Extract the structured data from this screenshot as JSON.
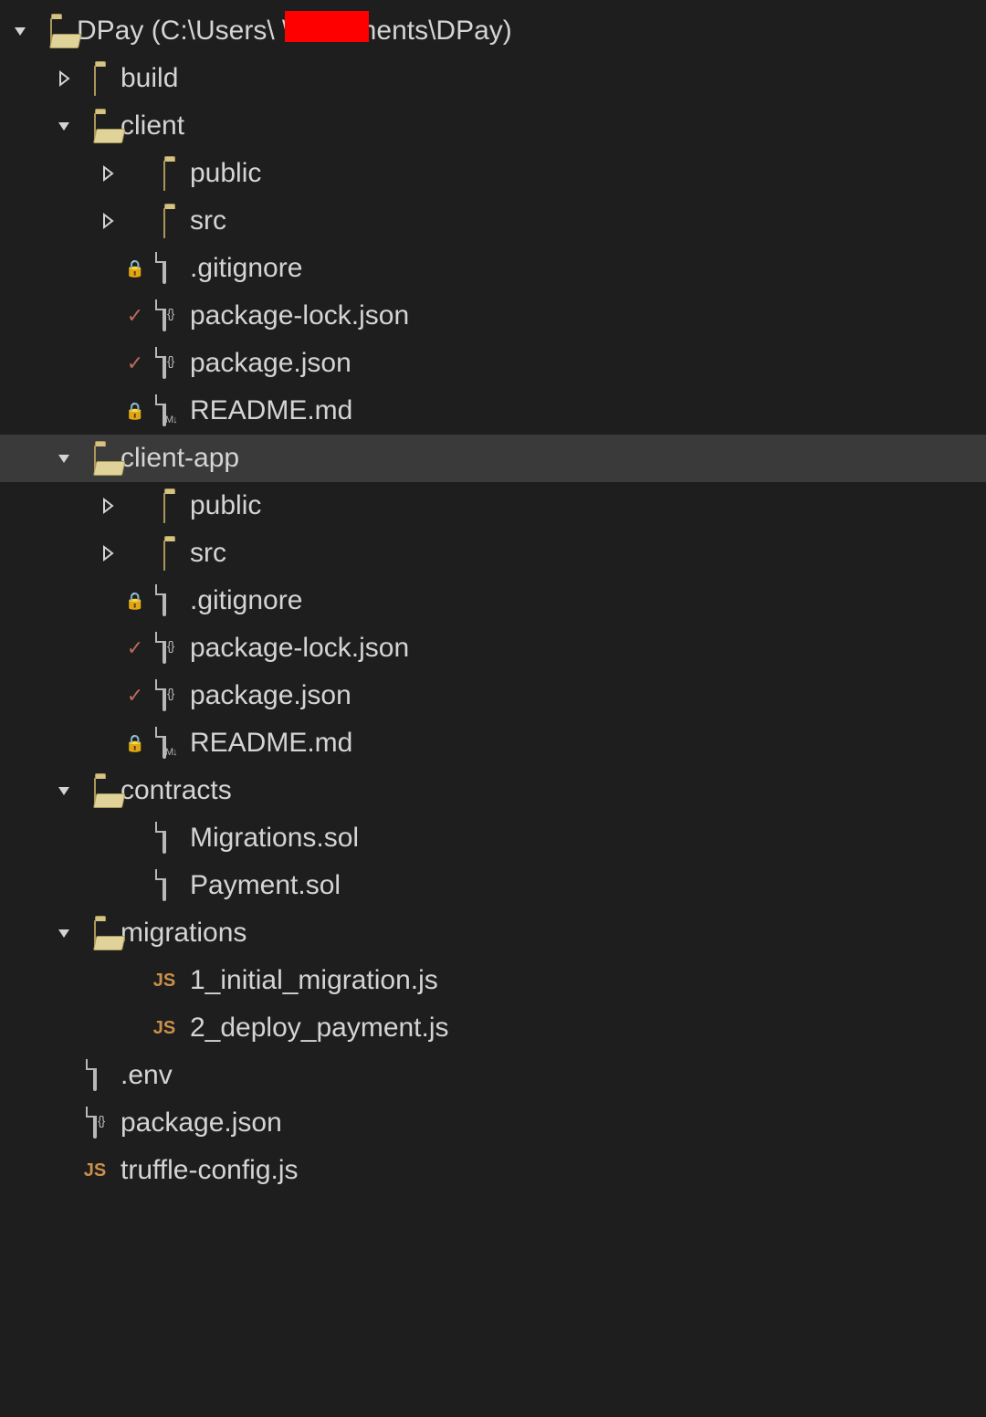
{
  "rootLabel": "DPay (C:\\Users\\        \\Documents\\DPay)",
  "selectedLabel": "client-app",
  "nodes": [
    {
      "depth": 0,
      "expander": "down",
      "icon": "folder-open",
      "label_key": "n0",
      "redact": true
    },
    {
      "depth": 1,
      "expander": "right",
      "icon": "folder",
      "label_key": "n1"
    },
    {
      "depth": 1,
      "expander": "down",
      "icon": "folder-open",
      "label_key": "n2"
    },
    {
      "depth": 2,
      "expander": "right",
      "icon": "folder",
      "label_key": "n3"
    },
    {
      "depth": 2,
      "expander": "right",
      "icon": "folder",
      "label_key": "n4"
    },
    {
      "depth": 2,
      "status": "lock",
      "icon": "file",
      "label_key": "n5"
    },
    {
      "depth": 2,
      "status": "check",
      "icon": "file-json",
      "label_key": "n6"
    },
    {
      "depth": 2,
      "status": "check",
      "icon": "file-json",
      "label_key": "n7"
    },
    {
      "depth": 2,
      "status": "lock",
      "icon": "file-md",
      "label_key": "n8"
    },
    {
      "depth": 1,
      "expander": "down",
      "icon": "folder-open",
      "label_key": "n9",
      "selected": true
    },
    {
      "depth": 2,
      "expander": "right",
      "icon": "folder",
      "label_key": "n10"
    },
    {
      "depth": 2,
      "expander": "right",
      "icon": "folder",
      "label_key": "n11"
    },
    {
      "depth": 2,
      "status": "lock",
      "icon": "file",
      "label_key": "n12"
    },
    {
      "depth": 2,
      "status": "check",
      "icon": "file-json",
      "label_key": "n13"
    },
    {
      "depth": 2,
      "status": "check",
      "icon": "file-json",
      "label_key": "n14"
    },
    {
      "depth": 2,
      "status": "lock",
      "icon": "file-md",
      "label_key": "n15"
    },
    {
      "depth": 1,
      "expander": "down",
      "icon": "folder-open",
      "label_key": "n16"
    },
    {
      "depth": 2,
      "icon": "file",
      "label_key": "n17"
    },
    {
      "depth": 2,
      "icon": "file",
      "label_key": "n18"
    },
    {
      "depth": 1,
      "expander": "down",
      "icon": "folder-open",
      "label_key": "n19"
    },
    {
      "depth": 2,
      "icon": "file-js",
      "label_key": "n20"
    },
    {
      "depth": 2,
      "icon": "file-js",
      "label_key": "n21"
    },
    {
      "depth": 1,
      "icon": "file",
      "label_key": "n22"
    },
    {
      "depth": 1,
      "icon": "file-json",
      "label_key": "n23"
    },
    {
      "depth": 1,
      "icon": "file-js",
      "label_key": "n24"
    }
  ],
  "labels": {
    "n0": "DPay (C:\\Users\\        \\Documents\\DPay)",
    "n1": "build",
    "n2": "client",
    "n3": "public",
    "n4": "src",
    "n5": ".gitignore",
    "n6": "package-lock.json",
    "n7": "package.json",
    "n8": "README.md",
    "n9": "client-app",
    "n10": "public",
    "n11": "src",
    "n12": ".gitignore",
    "n13": "package-lock.json",
    "n14": "package.json",
    "n15": "README.md",
    "n16": "contracts",
    "n17": "Migrations.sol",
    "n18": "Payment.sol",
    "n19": "migrations",
    "n20": "1_initial_migration.js",
    "n21": "2_deploy_payment.js",
    "n22": ".env",
    "n23": "package.json",
    "n24": "truffle-config.js"
  }
}
